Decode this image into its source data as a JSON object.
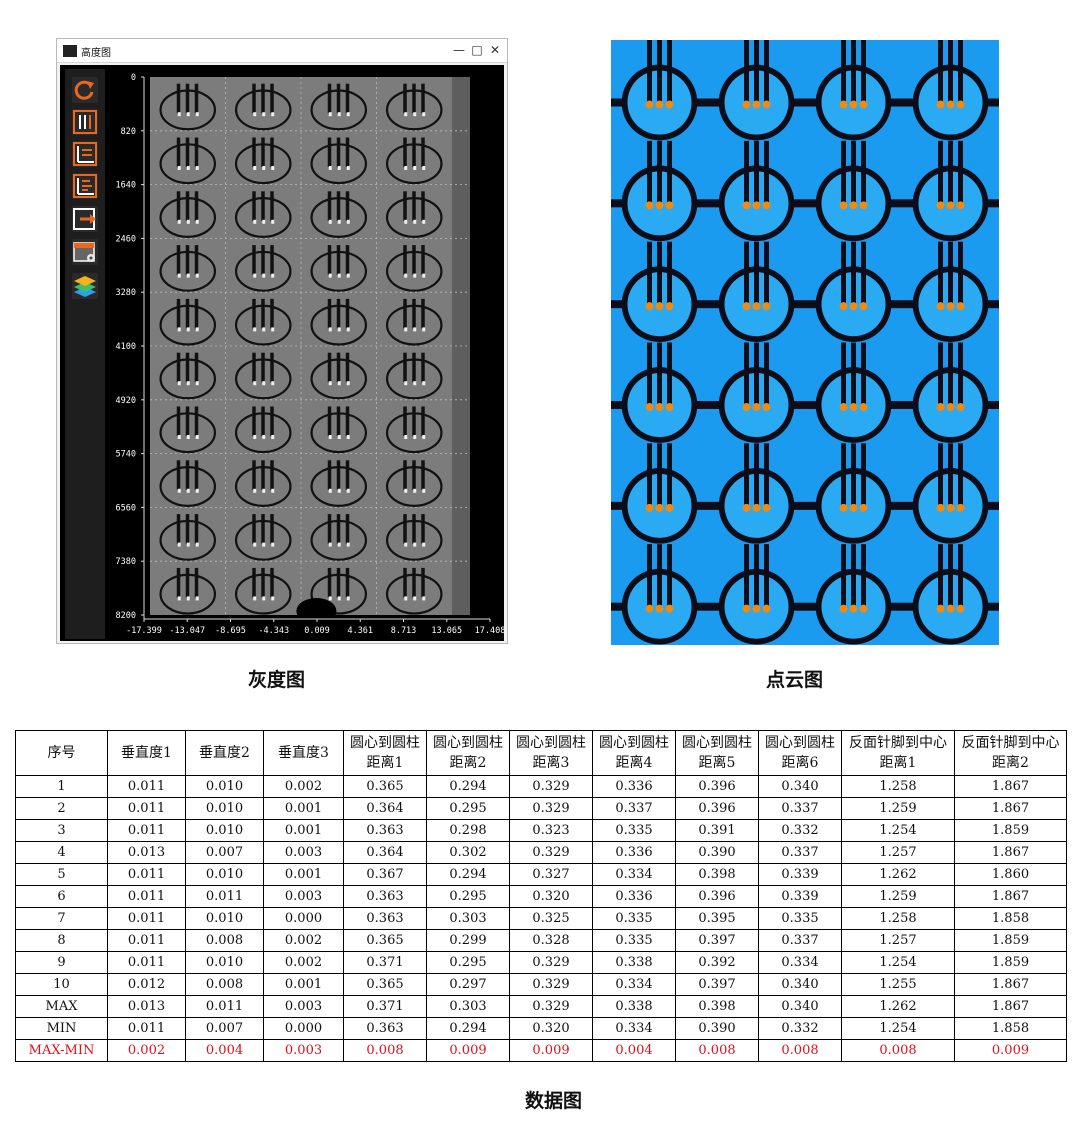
{
  "window": {
    "title": "高度图",
    "controls": {
      "minimize": "—",
      "maximize": "□",
      "close": "✕"
    }
  },
  "toolbar": {
    "buttons": [
      {
        "name": "refresh-icon",
        "color": "#e8681e"
      },
      {
        "name": "vertical-measure-icon",
        "color": "#e8681e"
      },
      {
        "name": "axis-measure-icon",
        "color": "#e8681e"
      },
      {
        "name": "axis-measure-2-icon",
        "color": "#e8681e"
      },
      {
        "name": "export-icon",
        "color": "#e8681e"
      },
      {
        "name": "image-settings-icon",
        "color": "#e8681e"
      },
      {
        "name": "layers-icon",
        "color": "#2aa1e8"
      }
    ]
  },
  "plot": {
    "y_ticks": [
      "0",
      "820",
      "1640",
      "2460",
      "3280",
      "4100",
      "4920",
      "5740",
      "6560",
      "7380",
      "8200"
    ],
    "x_ticks": [
      "-17.399",
      "-13.047",
      "-8.695",
      "-4.343",
      "0.009",
      "4.361",
      "8.713",
      "13.065",
      "17.408"
    ]
  },
  "captions": {
    "gray": "灰度图",
    "cloud": "点云图",
    "data": "数据图"
  },
  "colors": {
    "cloud_bg": "#1b9bf0",
    "pin": "#f08a12",
    "red": "#e0101b"
  },
  "table": {
    "headers": [
      {
        "l1": "序号",
        "l2": ""
      },
      {
        "l1": "垂直度1",
        "l2": ""
      },
      {
        "l1": "垂直度2",
        "l2": ""
      },
      {
        "l1": "垂直度3",
        "l2": ""
      },
      {
        "l1": "圆心到圆柱",
        "l2": "距离1"
      },
      {
        "l1": "圆心到圆柱",
        "l2": "距离2"
      },
      {
        "l1": "圆心到圆柱",
        "l2": "距离3"
      },
      {
        "l1": "圆心到圆柱",
        "l2": "距离4"
      },
      {
        "l1": "圆心到圆柱",
        "l2": "距离5"
      },
      {
        "l1": "圆心到圆柱",
        "l2": "距离6"
      },
      {
        "l1": "反面针脚到中心",
        "l2": "距离1"
      },
      {
        "l1": "反面针脚到中心",
        "l2": "距离2"
      }
    ],
    "rows": [
      [
        "1",
        "0.011",
        "0.010",
        "0.002",
        "0.365",
        "0.294",
        "0.329",
        "0.336",
        "0.396",
        "0.340",
        "1.258",
        "1.867"
      ],
      [
        "2",
        "0.011",
        "0.010",
        "0.001",
        "0.364",
        "0.295",
        "0.329",
        "0.337",
        "0.396",
        "0.337",
        "1.259",
        "1.867"
      ],
      [
        "3",
        "0.011",
        "0.010",
        "0.001",
        "0.363",
        "0.298",
        "0.323",
        "0.335",
        "0.391",
        "0.332",
        "1.254",
        "1.859"
      ],
      [
        "4",
        "0.013",
        "0.007",
        "0.003",
        "0.364",
        "0.302",
        "0.329",
        "0.336",
        "0.390",
        "0.337",
        "1.257",
        "1.867"
      ],
      [
        "5",
        "0.011",
        "0.010",
        "0.001",
        "0.367",
        "0.294",
        "0.327",
        "0.334",
        "0.398",
        "0.339",
        "1.262",
        "1.860"
      ],
      [
        "6",
        "0.011",
        "0.011",
        "0.003",
        "0.363",
        "0.295",
        "0.320",
        "0.336",
        "0.396",
        "0.339",
        "1.259",
        "1.867"
      ],
      [
        "7",
        "0.011",
        "0.010",
        "0.000",
        "0.363",
        "0.303",
        "0.325",
        "0.335",
        "0.395",
        "0.335",
        "1.258",
        "1.858"
      ],
      [
        "8",
        "0.011",
        "0.008",
        "0.002",
        "0.365",
        "0.299",
        "0.328",
        "0.335",
        "0.397",
        "0.337",
        "1.257",
        "1.859"
      ],
      [
        "9",
        "0.011",
        "0.010",
        "0.002",
        "0.371",
        "0.295",
        "0.329",
        "0.338",
        "0.392",
        "0.334",
        "1.254",
        "1.859"
      ],
      [
        "10",
        "0.012",
        "0.008",
        "0.001",
        "0.365",
        "0.297",
        "0.329",
        "0.334",
        "0.397",
        "0.340",
        "1.255",
        "1.867"
      ],
      [
        "MAX",
        "0.013",
        "0.011",
        "0.003",
        "0.371",
        "0.303",
        "0.329",
        "0.338",
        "0.398",
        "0.340",
        "1.262",
        "1.867"
      ],
      [
        "MIN",
        "0.011",
        "0.007",
        "0.000",
        "0.363",
        "0.294",
        "0.320",
        "0.334",
        "0.390",
        "0.332",
        "1.254",
        "1.858"
      ],
      [
        "MAX-MIN",
        "0.002",
        "0.004",
        "0.003",
        "0.008",
        "0.009",
        "0.009",
        "0.004",
        "0.008",
        "0.008",
        "0.008",
        "0.009"
      ]
    ]
  }
}
